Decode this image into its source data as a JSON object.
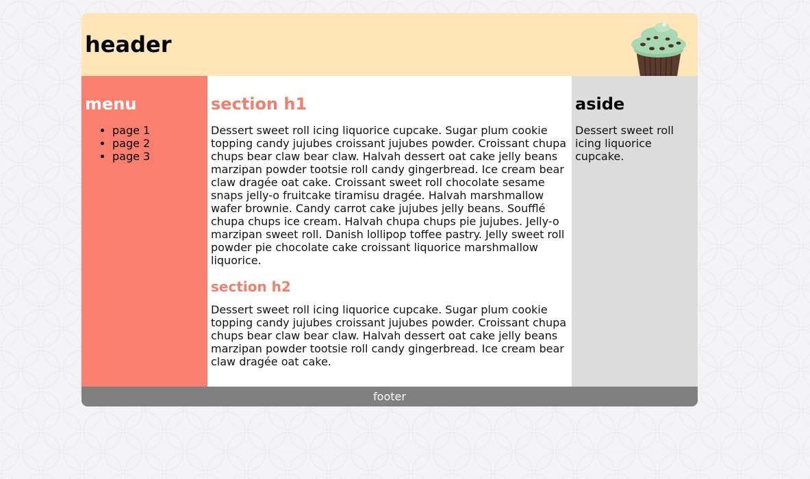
{
  "header": {
    "title": "header"
  },
  "menu": {
    "title": "menu",
    "items": [
      "page 1",
      "page 2",
      "page 3"
    ]
  },
  "main": {
    "h1": "section h1",
    "p1": "Dessert sweet roll icing liquorice cupcake. Sugar plum cookie topping candy jujubes croissant jujubes powder. Croissant chupa chups bear claw bear claw. Halvah dessert oat cake jelly beans marzipan powder tootsie roll candy gingerbread. Ice cream bear claw dragée oat cake. Croissant sweet roll chocolate sesame snaps jelly-o fruitcake tiramisu dragée. Halvah marshmallow wafer brownie. Candy carrot cake jujubes jelly beans. Soufflé chupa chups ice cream. Halvah chupa chups pie jujubes. Jelly-o marzipan sweet roll. Danish lollipop toffee pastry. Jelly sweet roll powder pie chocolate cake croissant liquorice marshmallow liquorice.",
    "h2": "section h2",
    "p2": "Dessert sweet roll icing liquorice cupcake. Sugar plum cookie topping candy jujubes croissant jujubes powder. Croissant chupa chups bear claw bear claw. Halvah dessert oat cake jelly beans marzipan powder tootsie roll candy gingerbread. Ice cream bear claw dragée oat cake."
  },
  "aside": {
    "title": "aside",
    "text": "Dessert sweet roll icing liquorice cupcake."
  },
  "footer": {
    "text": "footer"
  },
  "icons": {
    "header_image": "cupcake-icon"
  },
  "colors": {
    "header_bg": "#ffe6b8",
    "menu_bg": "#fa7f6e",
    "main_bg": "#ffffff",
    "aside_bg": "#dcdcdc",
    "footer_bg": "#808080",
    "section_heading": "#f07f6c"
  }
}
